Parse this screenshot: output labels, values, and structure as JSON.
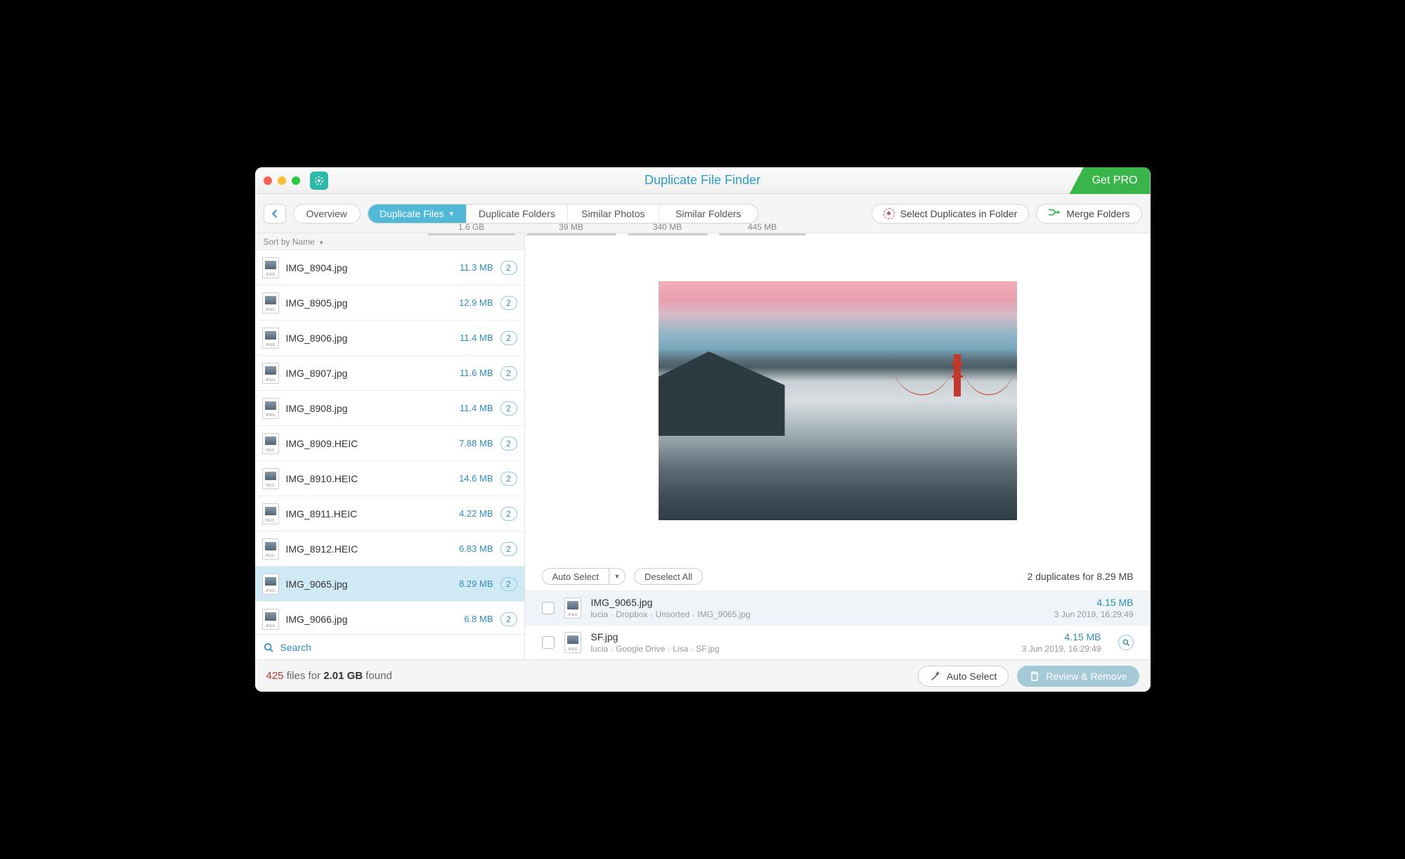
{
  "window": {
    "title": "Duplicate File Finder",
    "get_pro": "Get PRO"
  },
  "toolbar": {
    "overview": "Overview",
    "tabs": [
      {
        "label": "Duplicate Files",
        "size": "1.6 GB",
        "active": true
      },
      {
        "label": "Duplicate Folders",
        "size": "39 MB",
        "active": false
      },
      {
        "label": "Similar Photos",
        "size": "340 MB",
        "active": false
      },
      {
        "label": "Similar Folders",
        "size": "445 MB",
        "active": false
      }
    ],
    "select_in_folder": "Select Duplicates in Folder",
    "merge_folders": "Merge Folders"
  },
  "sidebar": {
    "sort_label": "Sort by Name",
    "search_placeholder": "Search",
    "files": [
      {
        "name": "IMG_8904.jpg",
        "size": "11.3 MB",
        "count": "2",
        "ext": "JPEG"
      },
      {
        "name": "IMG_8905.jpg",
        "size": "12.9 MB",
        "count": "2",
        "ext": "JPEG"
      },
      {
        "name": "IMG_8906.jpg",
        "size": "11.4 MB",
        "count": "2",
        "ext": "JPEG"
      },
      {
        "name": "IMG_8907.jpg",
        "size": "11.6 MB",
        "count": "2",
        "ext": "JPEG"
      },
      {
        "name": "IMG_8908.jpg",
        "size": "11.4 MB",
        "count": "2",
        "ext": "JPEG"
      },
      {
        "name": "IMG_8909.HEIC",
        "size": "7.88 MB",
        "count": "2",
        "ext": "HEIC"
      },
      {
        "name": "IMG_8910.HEIC",
        "size": "14.6 MB",
        "count": "2",
        "ext": "HEIC"
      },
      {
        "name": "IMG_8911.HEIC",
        "size": "4.22 MB",
        "count": "2",
        "ext": "HEIC"
      },
      {
        "name": "IMG_8912.HEIC",
        "size": "6.83 MB",
        "count": "2",
        "ext": "HEIC"
      },
      {
        "name": "IMG_9065.jpg",
        "size": "8.29 MB",
        "count": "2",
        "ext": "JPEG",
        "selected": true
      },
      {
        "name": "IMG_9066.jpg",
        "size": "6.8 MB",
        "count": "2",
        "ext": "JPEG"
      }
    ]
  },
  "detail": {
    "auto_select": "Auto Select",
    "deselect_all": "Deselect All",
    "summary": "2 duplicates for 8.29 MB",
    "items": [
      {
        "name": "IMG_9065.jpg",
        "path": [
          "lucia",
          "Dropbox",
          "Unsorted",
          "IMG_9065.jpg"
        ],
        "size": "4.15 MB",
        "date": "3 Jun 2019, 16:29:49",
        "selected": true
      },
      {
        "name": "SF.jpg",
        "path": [
          "lucia",
          "Google Drive",
          "Lisa",
          "SF.jpg"
        ],
        "size": "4.15 MB",
        "date": "3 Jun 2019, 16:29:49",
        "selected": false
      }
    ]
  },
  "footer": {
    "count": "425",
    "mid": " files for ",
    "size": "2.01 GB",
    "suffix": " found",
    "auto_select": "Auto Select",
    "review_remove": "Review & Remove"
  }
}
